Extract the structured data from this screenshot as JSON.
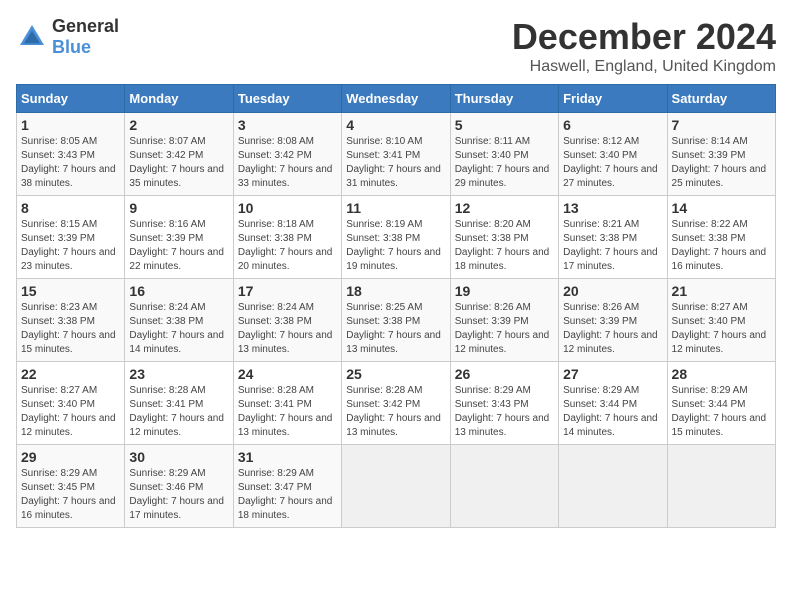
{
  "header": {
    "logo_general": "General",
    "logo_blue": "Blue",
    "title": "December 2024",
    "location": "Haswell, England, United Kingdom"
  },
  "days_of_week": [
    "Sunday",
    "Monday",
    "Tuesday",
    "Wednesday",
    "Thursday",
    "Friday",
    "Saturday"
  ],
  "weeks": [
    [
      {
        "day": "1",
        "sunrise": "Sunrise: 8:05 AM",
        "sunset": "Sunset: 3:43 PM",
        "daylight": "Daylight: 7 hours and 38 minutes."
      },
      {
        "day": "2",
        "sunrise": "Sunrise: 8:07 AM",
        "sunset": "Sunset: 3:42 PM",
        "daylight": "Daylight: 7 hours and 35 minutes."
      },
      {
        "day": "3",
        "sunrise": "Sunrise: 8:08 AM",
        "sunset": "Sunset: 3:42 PM",
        "daylight": "Daylight: 7 hours and 33 minutes."
      },
      {
        "day": "4",
        "sunrise": "Sunrise: 8:10 AM",
        "sunset": "Sunset: 3:41 PM",
        "daylight": "Daylight: 7 hours and 31 minutes."
      },
      {
        "day": "5",
        "sunrise": "Sunrise: 8:11 AM",
        "sunset": "Sunset: 3:40 PM",
        "daylight": "Daylight: 7 hours and 29 minutes."
      },
      {
        "day": "6",
        "sunrise": "Sunrise: 8:12 AM",
        "sunset": "Sunset: 3:40 PM",
        "daylight": "Daylight: 7 hours and 27 minutes."
      },
      {
        "day": "7",
        "sunrise": "Sunrise: 8:14 AM",
        "sunset": "Sunset: 3:39 PM",
        "daylight": "Daylight: 7 hours and 25 minutes."
      }
    ],
    [
      {
        "day": "8",
        "sunrise": "Sunrise: 8:15 AM",
        "sunset": "Sunset: 3:39 PM",
        "daylight": "Daylight: 7 hours and 23 minutes."
      },
      {
        "day": "9",
        "sunrise": "Sunrise: 8:16 AM",
        "sunset": "Sunset: 3:39 PM",
        "daylight": "Daylight: 7 hours and 22 minutes."
      },
      {
        "day": "10",
        "sunrise": "Sunrise: 8:18 AM",
        "sunset": "Sunset: 3:38 PM",
        "daylight": "Daylight: 7 hours and 20 minutes."
      },
      {
        "day": "11",
        "sunrise": "Sunrise: 8:19 AM",
        "sunset": "Sunset: 3:38 PM",
        "daylight": "Daylight: 7 hours and 19 minutes."
      },
      {
        "day": "12",
        "sunrise": "Sunrise: 8:20 AM",
        "sunset": "Sunset: 3:38 PM",
        "daylight": "Daylight: 7 hours and 18 minutes."
      },
      {
        "day": "13",
        "sunrise": "Sunrise: 8:21 AM",
        "sunset": "Sunset: 3:38 PM",
        "daylight": "Daylight: 7 hours and 17 minutes."
      },
      {
        "day": "14",
        "sunrise": "Sunrise: 8:22 AM",
        "sunset": "Sunset: 3:38 PM",
        "daylight": "Daylight: 7 hours and 16 minutes."
      }
    ],
    [
      {
        "day": "15",
        "sunrise": "Sunrise: 8:23 AM",
        "sunset": "Sunset: 3:38 PM",
        "daylight": "Daylight: 7 hours and 15 minutes."
      },
      {
        "day": "16",
        "sunrise": "Sunrise: 8:24 AM",
        "sunset": "Sunset: 3:38 PM",
        "daylight": "Daylight: 7 hours and 14 minutes."
      },
      {
        "day": "17",
        "sunrise": "Sunrise: 8:24 AM",
        "sunset": "Sunset: 3:38 PM",
        "daylight": "Daylight: 7 hours and 13 minutes."
      },
      {
        "day": "18",
        "sunrise": "Sunrise: 8:25 AM",
        "sunset": "Sunset: 3:38 PM",
        "daylight": "Daylight: 7 hours and 13 minutes."
      },
      {
        "day": "19",
        "sunrise": "Sunrise: 8:26 AM",
        "sunset": "Sunset: 3:39 PM",
        "daylight": "Daylight: 7 hours and 12 minutes."
      },
      {
        "day": "20",
        "sunrise": "Sunrise: 8:26 AM",
        "sunset": "Sunset: 3:39 PM",
        "daylight": "Daylight: 7 hours and 12 minutes."
      },
      {
        "day": "21",
        "sunrise": "Sunrise: 8:27 AM",
        "sunset": "Sunset: 3:40 PM",
        "daylight": "Daylight: 7 hours and 12 minutes."
      }
    ],
    [
      {
        "day": "22",
        "sunrise": "Sunrise: 8:27 AM",
        "sunset": "Sunset: 3:40 PM",
        "daylight": "Daylight: 7 hours and 12 minutes."
      },
      {
        "day": "23",
        "sunrise": "Sunrise: 8:28 AM",
        "sunset": "Sunset: 3:41 PM",
        "daylight": "Daylight: 7 hours and 12 minutes."
      },
      {
        "day": "24",
        "sunrise": "Sunrise: 8:28 AM",
        "sunset": "Sunset: 3:41 PM",
        "daylight": "Daylight: 7 hours and 13 minutes."
      },
      {
        "day": "25",
        "sunrise": "Sunrise: 8:28 AM",
        "sunset": "Sunset: 3:42 PM",
        "daylight": "Daylight: 7 hours and 13 minutes."
      },
      {
        "day": "26",
        "sunrise": "Sunrise: 8:29 AM",
        "sunset": "Sunset: 3:43 PM",
        "daylight": "Daylight: 7 hours and 13 minutes."
      },
      {
        "day": "27",
        "sunrise": "Sunrise: 8:29 AM",
        "sunset": "Sunset: 3:44 PM",
        "daylight": "Daylight: 7 hours and 14 minutes."
      },
      {
        "day": "28",
        "sunrise": "Sunrise: 8:29 AM",
        "sunset": "Sunset: 3:44 PM",
        "daylight": "Daylight: 7 hours and 15 minutes."
      }
    ],
    [
      {
        "day": "29",
        "sunrise": "Sunrise: 8:29 AM",
        "sunset": "Sunset: 3:45 PM",
        "daylight": "Daylight: 7 hours and 16 minutes."
      },
      {
        "day": "30",
        "sunrise": "Sunrise: 8:29 AM",
        "sunset": "Sunset: 3:46 PM",
        "daylight": "Daylight: 7 hours and 17 minutes."
      },
      {
        "day": "31",
        "sunrise": "Sunrise: 8:29 AM",
        "sunset": "Sunset: 3:47 PM",
        "daylight": "Daylight: 7 hours and 18 minutes."
      },
      null,
      null,
      null,
      null
    ]
  ]
}
